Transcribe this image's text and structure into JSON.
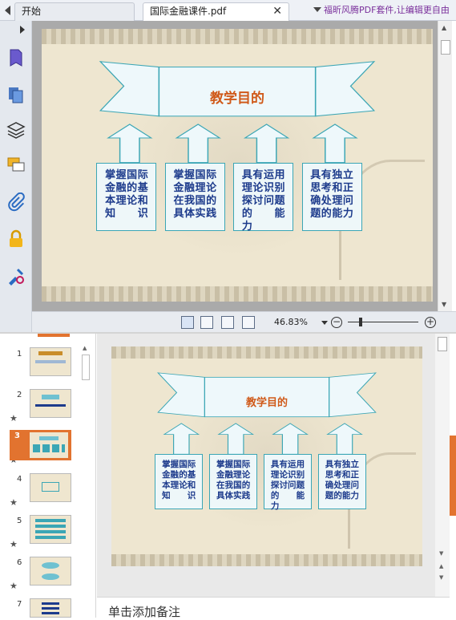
{
  "tabs": [
    {
      "label": "开始"
    },
    {
      "label": "国际金融课件.pdf"
    }
  ],
  "promo_text": "福昕风腾PDF套件,让编辑更自由",
  "sidebar_icons": [
    "bookmark-icon",
    "pages-icon",
    "layers-icon",
    "comments-icon",
    "attachments-icon",
    "security-icon",
    "signature-icon"
  ],
  "status": {
    "zoom": "46.83%",
    "minus": "−",
    "plus": "+"
  },
  "slide": {
    "title": "教学目的",
    "boxes": [
      "掌握国际金融的基本理论和知　识",
      "掌握国际金融理论在我国的具体实践",
      "具有运用理论识别探讨问题的　能　力",
      "具有独立思考和正确处理问题的能力"
    ],
    "colors": {
      "title": "#d05a1a",
      "box_text": "#1d3b8c",
      "box_border": "#3ba6b5",
      "background": "#eee6d0"
    }
  },
  "thumbnails": {
    "numbers": [
      "1",
      "2",
      "3",
      "4",
      "5",
      "6",
      "7"
    ],
    "selected": "3",
    "star": "★"
  },
  "notes": {
    "placeholder": "单击添加备注"
  },
  "accent": "#e2732f"
}
